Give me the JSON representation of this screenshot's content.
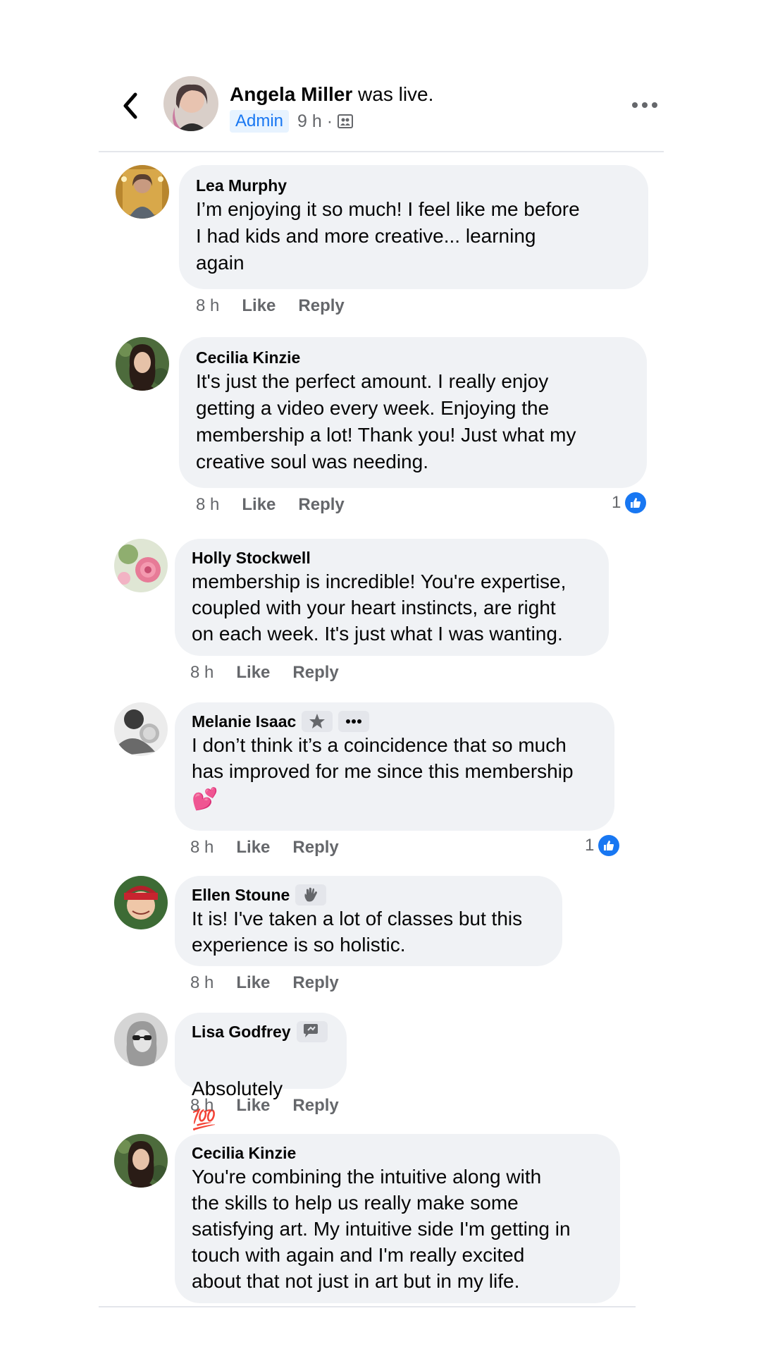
{
  "header": {
    "author": "Angela Miller",
    "status": "was live.",
    "badge": "Admin",
    "time": "9 h ·",
    "privacy_icon": "group-icon",
    "back_icon": "chevron-left-icon",
    "more_icon": "more-horizontal-icon"
  },
  "comments": [
    {
      "author": "Lea Murphy",
      "text": "I’m enjoying it so much! I feel like me before\nI had kids and more creative... learning\nagain",
      "time": "8 h",
      "like": "Like",
      "reply": "Reply"
    },
    {
      "author": "Cecilia Kinzie",
      "text": "It's just the perfect amount. I really enjoy\ngetting a video every week. Enjoying the\nmembership a lot! Thank you! Just what my\ncreative soul was needing.",
      "time": "8 h",
      "like": "Like",
      "reply": "Reply",
      "reaction_count": "1"
    },
    {
      "author": "Holly Stockwell",
      "text": "membership is incredible! You're expertise,\ncoupled with your heart instincts, are right\non each week. It's just what I was wanting.",
      "time": "8 h",
      "like": "Like",
      "reply": "Reply"
    },
    {
      "author": "Melanie Isaac",
      "text": "I don’t think it’s a coincidence that so much\nhas improved for me since this membership",
      "emoji": "💕",
      "time": "8 h",
      "like": "Like",
      "reply": "Reply",
      "reaction_count": "1",
      "badges": [
        "star-badge-icon",
        "more-horizontal-icon"
      ]
    },
    {
      "author": "Ellen Stoune",
      "text": "It is! I've taken a lot of classes but this\nexperience is so holistic.",
      "time": "8 h",
      "like": "Like",
      "reply": "Reply",
      "badges": [
        "waving-hand-icon"
      ]
    },
    {
      "author": "Lisa Godfrey",
      "text": "Absolutely",
      "emoji": "💯",
      "time": "8 h",
      "like": "Like",
      "reply": "Reply",
      "badges": [
        "conversation-starter-icon"
      ]
    },
    {
      "author": "Cecilia Kinzie",
      "text": "You're combining the intuitive along with\nthe skills to help us really make some\nsatisfying art. My intuitive side I'm getting in\ntouch with again and I'm really excited\nabout that not just in art but in my life."
    }
  ],
  "colors": {
    "bubble": "#f0f2f5",
    "secondary_text": "#65676b",
    "accent": "#1877f2",
    "admin_badge_bg": "#e7f3ff"
  }
}
